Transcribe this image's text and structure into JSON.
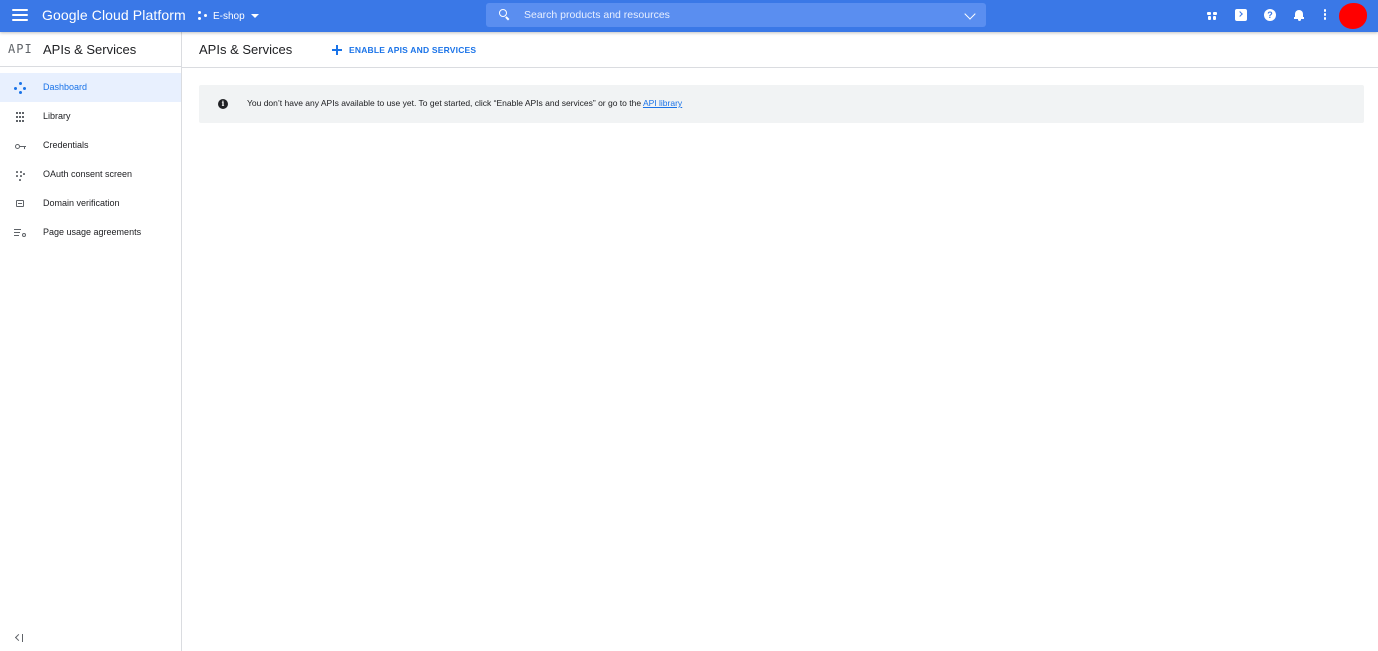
{
  "topbar": {
    "brand": "Google Cloud Platform",
    "project_name": "E-shop",
    "search_placeholder": "Search products and resources",
    "help_glyph": "?",
    "accent_color": "#3a78e7",
    "icons": [
      "menu-icon",
      "project-icon",
      "search-icon",
      "chevron-down-icon",
      "gift-icon",
      "cloud-shell-icon",
      "help-icon",
      "notifications-icon",
      "more-vert-icon",
      "avatar"
    ]
  },
  "sidebar": {
    "logo": "API",
    "title": "APIs & Services",
    "items": [
      {
        "label": "Dashboard",
        "icon": "dashboard-icon",
        "active": true
      },
      {
        "label": "Library",
        "icon": "library-icon",
        "active": false
      },
      {
        "label": "Credentials",
        "icon": "key-icon",
        "active": false
      },
      {
        "label": "OAuth consent screen",
        "icon": "oauth-consent-icon",
        "active": false
      },
      {
        "label": "Domain verification",
        "icon": "domain-verification-icon",
        "active": false
      },
      {
        "label": "Page usage agreements",
        "icon": "page-usage-icon",
        "active": false
      }
    ],
    "active_color": "#1a73e8",
    "active_bg": "#e8f0fe"
  },
  "main": {
    "title": "APIs & Services",
    "enable_button": "ENABLE APIS AND SERVICES",
    "notice": {
      "info_glyph": "i",
      "text": "You don’t have any APIs available to use yet. To get started, click “Enable APIs and services” or go to the ",
      "link": "API library"
    }
  }
}
